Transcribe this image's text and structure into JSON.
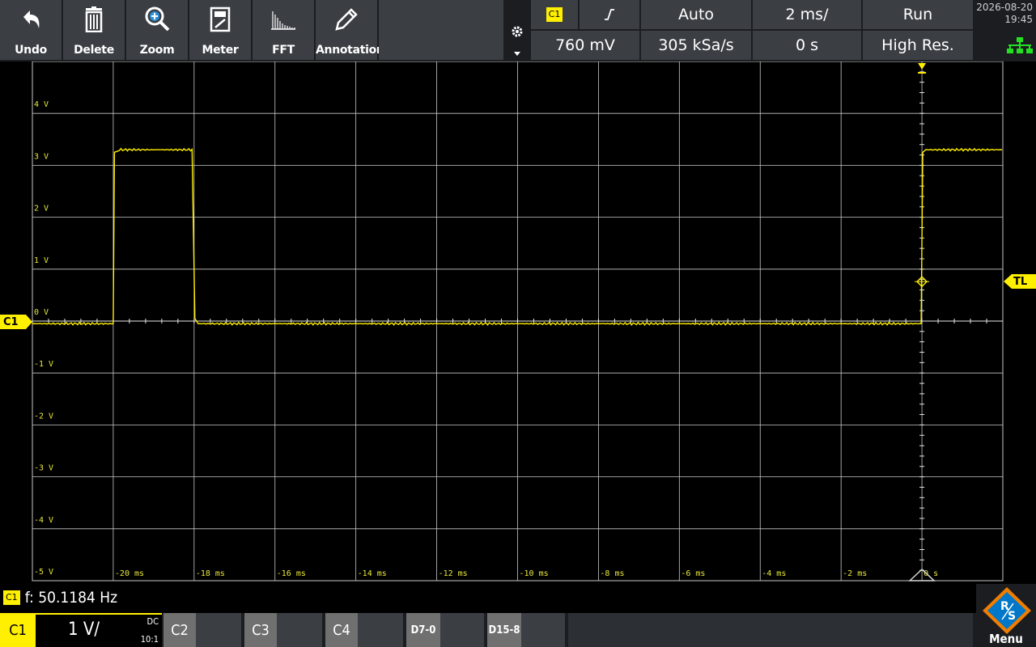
{
  "toolbar": {
    "buttons": [
      {
        "label": "Undo",
        "icon": "undo-icon"
      },
      {
        "label": "Delete",
        "icon": "trash-icon"
      },
      {
        "label": "Zoom",
        "icon": "zoom-in-icon"
      },
      {
        "label": "Meter",
        "icon": "meter-icon"
      },
      {
        "label": "FFT",
        "icon": "fft-icon"
      },
      {
        "label": "Annotation",
        "icon": "pencil-icon"
      }
    ]
  },
  "trigger": {
    "source": "C1",
    "slope_symbol": "╯",
    "mode": "Auto",
    "timebase": "2 ms/",
    "run_state": "Run",
    "level": "760 mV",
    "sample_rate": "305 kSa/s",
    "position": "0 s",
    "acq_mode": "High Res."
  },
  "status": {
    "date": "2026-08-20",
    "time": "19:45",
    "network_icon": "network-icon"
  },
  "grid": {
    "y_labels": [
      "4 V",
      "3 V",
      "2 V",
      "1 V",
      "0 V",
      "-1 V",
      "-2 V",
      "-3 V",
      "-4 V",
      "-5 V"
    ],
    "x_labels": [
      "-20 ms",
      "-18 ms",
      "-16 ms",
      "-14 ms",
      "-12 ms",
      "-10 ms",
      "-8 ms",
      "-6 ms",
      "-4 ms",
      "-2 ms",
      "0 s"
    ]
  },
  "markers": {
    "channel": "C1",
    "trigger_level": "TL"
  },
  "measurement": {
    "channel": "C1",
    "text": "f: 50.1184 Hz"
  },
  "channels": {
    "c1": {
      "name": "C1",
      "scale": "1 V/",
      "coupling": "DC",
      "probe": "10:1"
    },
    "others": [
      "C2",
      "C3",
      "C4",
      "D7-0",
      "D15-8"
    ]
  },
  "menu": {
    "label": "Menu",
    "logo_text": "R&S"
  },
  "colors": {
    "trace": "#ffef00",
    "grid": "#c8c8c8",
    "button": "#3b3f44",
    "background": "#000000"
  }
}
